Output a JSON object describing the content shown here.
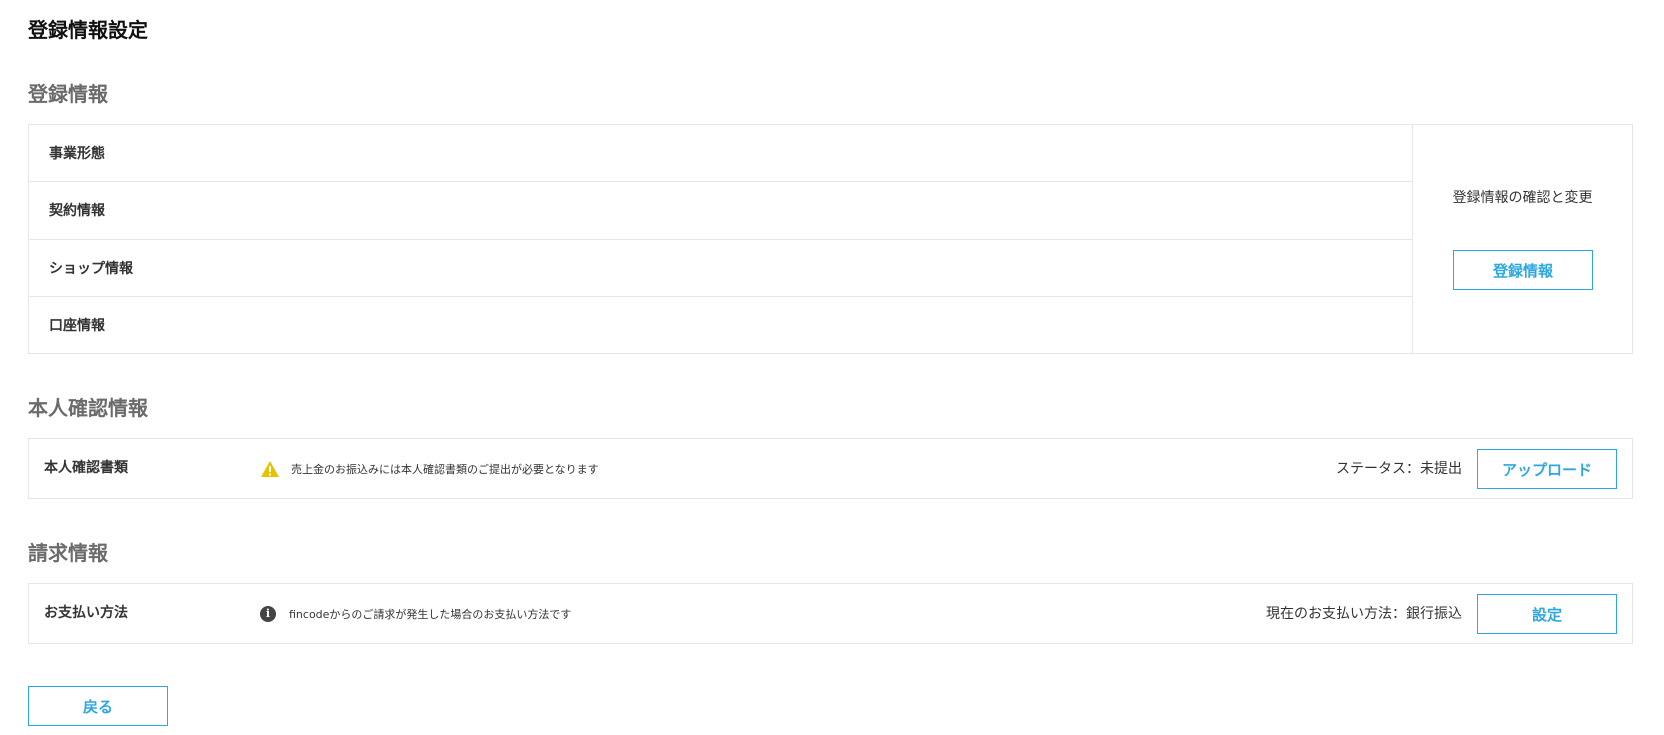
{
  "page": {
    "title": "登録情報設定"
  },
  "registration": {
    "section_title": "登録情報",
    "rows": [
      "事業形態",
      "契約情報",
      "ショップ情報",
      "口座情報"
    ],
    "side_caption": "登録情報の確認と変更",
    "button_label": "登録情報"
  },
  "identity": {
    "section_title": "本人確認情報",
    "label": "本人確認書類",
    "icon": "warning-icon",
    "message": "売上金のお振込みには本人確認書類のご提出が必要となります",
    "status": "ステータス：未提出",
    "button_label": "アップロード"
  },
  "billing": {
    "section_title": "請求情報",
    "label": "お支払い方法",
    "icon": "info-icon",
    "message": "fincodeからのご請求が発生した場合のお支払い方法です",
    "status": "現在のお支払い方法：銀行振込",
    "button_label": "設定"
  },
  "footer": {
    "back_label": "戻る"
  },
  "colors": {
    "accent": "#2ea7e0",
    "warning": "#e6c200",
    "border": "#e6e6e6",
    "section_title": "#6b6b6b"
  }
}
